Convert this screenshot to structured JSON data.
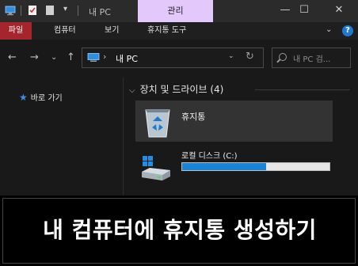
{
  "titlebar": {
    "title": "내 PC",
    "context_tab": "관리",
    "minimize": "—",
    "maximize": "☐",
    "close": "✕"
  },
  "ribbon": {
    "tabs": [
      "파일",
      "컴퓨터",
      "보기",
      "휴지통 도구"
    ],
    "collapse_glyph": "⌄",
    "help_glyph": "?"
  },
  "navigation": {
    "back": "←",
    "forward": "→",
    "recent": "⌄",
    "up": "↑",
    "address_sep": "›",
    "address": "내 PC",
    "address_dropdown": "⌄",
    "refresh": "↻",
    "search_placeholder": "내 PC 검..."
  },
  "nav_pane": {
    "quick_access": "바로 가기"
  },
  "content": {
    "group_title": "장치 및 드라이브 (4)",
    "items": [
      {
        "label": "휴지통",
        "icon": "recycle-bin-icon"
      },
      {
        "label": "로컬 디스크 (C:)",
        "icon": "local-disk-icon",
        "used_fraction": 0.57
      }
    ]
  },
  "caption": "내 컴퓨터에 휴지통 생성하기",
  "colors": {
    "file_tab": "#a4262c",
    "context_tab": "#e3c9fb",
    "drive_fill": "#1883d7",
    "accent": "#1e79d0"
  }
}
